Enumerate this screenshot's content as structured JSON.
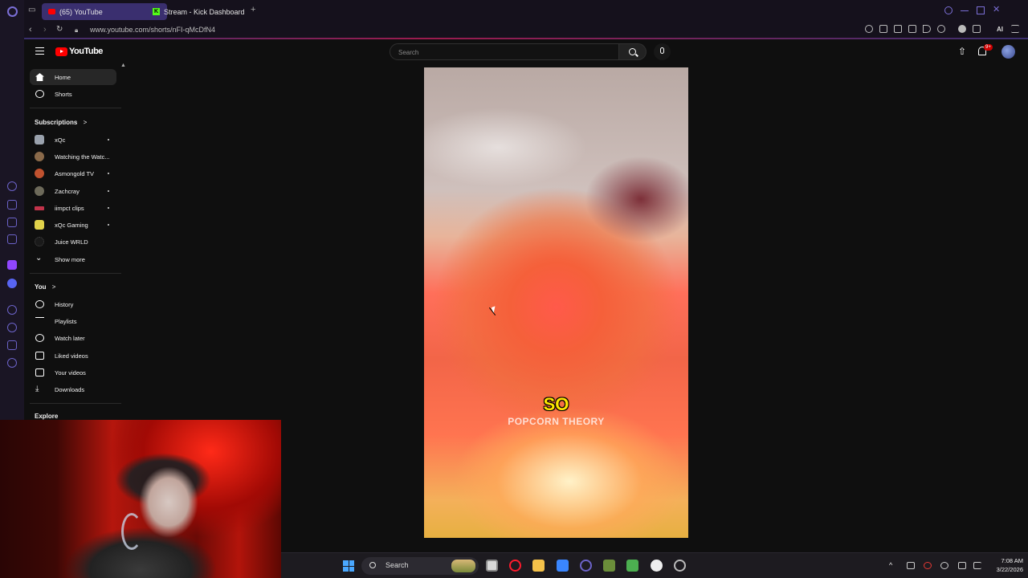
{
  "browser": {
    "tabs": [
      {
        "label": "(65) YouTube",
        "active": true
      },
      {
        "label": "Stream - Kick Dashboard",
        "active": false
      }
    ],
    "new_tab_label": "+",
    "url": "www.youtube.com/shorts/nFI-qMcDfN4",
    "ai_label": "AI"
  },
  "youtube": {
    "logo_text": "YouTube",
    "search_placeholder": "Search",
    "notification_count": "9+",
    "sidebar": {
      "primary": [
        {
          "label": "Home",
          "icon": "home-icon",
          "active": true
        },
        {
          "label": "Shorts",
          "icon": "shorts-icon",
          "active": false
        }
      ],
      "subscriptions_heading": "Subscriptions",
      "subscriptions_chevron": ">",
      "subscriptions": [
        {
          "label": "xQc",
          "live": true,
          "color": "#9aa2ad"
        },
        {
          "label": "Watching the Watc...",
          "live": false,
          "color": "#8a6a4a"
        },
        {
          "label": "Asmongold TV",
          "live": true,
          "color": "#c0522f"
        },
        {
          "label": "Zachcray",
          "live": true,
          "color": "#6d6a5a"
        },
        {
          "label": "iimpct clips",
          "live": true,
          "color": "#c2334a"
        },
        {
          "label": "xQc Gaming",
          "live": true,
          "color": "#e0d24a"
        },
        {
          "label": "Juice WRLD",
          "live": false,
          "color": "#1a1a1a"
        }
      ],
      "show_more": "Show more",
      "you_heading": "You",
      "you_chevron": ">",
      "you_items": [
        {
          "label": "History",
          "icon": "history-icon"
        },
        {
          "label": "Playlists",
          "icon": "playlists-icon"
        },
        {
          "label": "Watch later",
          "icon": "watch-later-icon"
        },
        {
          "label": "Liked videos",
          "icon": "liked-videos-icon"
        },
        {
          "label": "Your videos",
          "icon": "your-videos-icon"
        },
        {
          "label": "Downloads",
          "icon": "downloads-icon"
        }
      ],
      "explore_heading": "Explore"
    },
    "video": {
      "caption_main": "SO",
      "caption_sub": "POPCORN THEORY"
    }
  },
  "taskbar": {
    "search_label": "Search",
    "time": "7:08 AM",
    "date": "3/22/2026"
  },
  "colors": {
    "accent": "#7b6fd6",
    "youtube_red": "#ff0000",
    "caption_yellow": "#ffe600"
  }
}
